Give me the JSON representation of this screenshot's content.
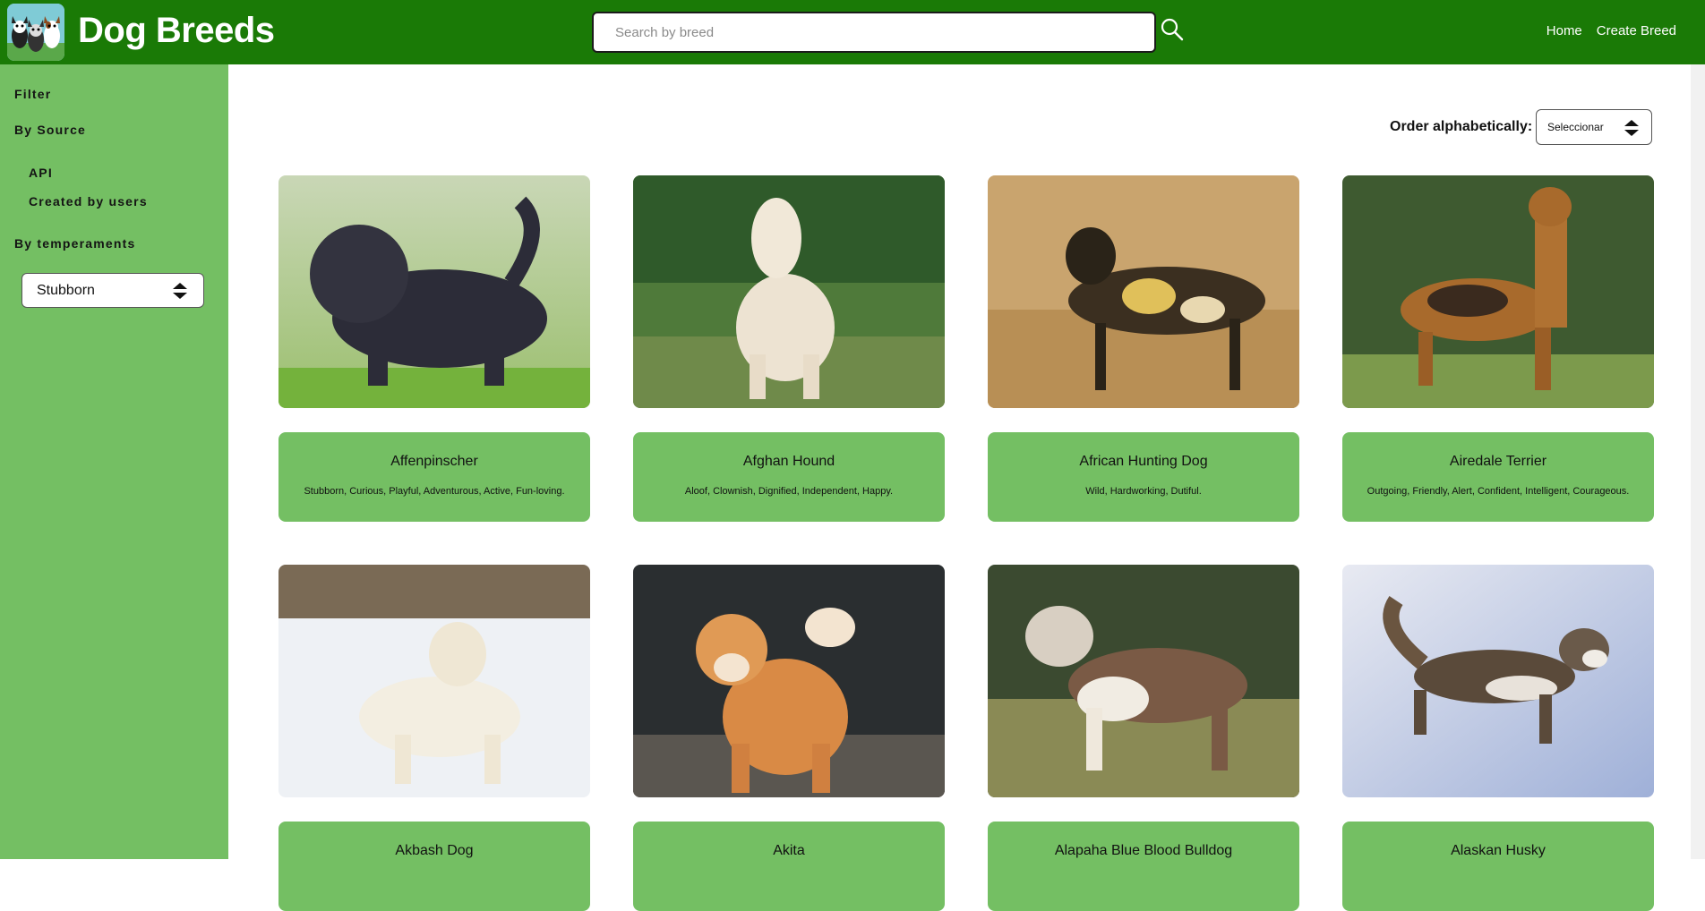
{
  "header": {
    "title": "Dog Breeds",
    "search_placeholder": "Search by breed",
    "nav": [
      "Home",
      "Create Breed"
    ]
  },
  "sidebar": {
    "filter_label": "Filter",
    "by_source_label": "By Source",
    "source_options": [
      "API",
      "Created by users"
    ],
    "by_temperaments_label": "By temperaments",
    "temperament_selected": "Stubborn"
  },
  "order": {
    "label": "Order alphabetically:",
    "selected": "Seleccionar"
  },
  "cards": [
    {
      "name": "Affenpinscher",
      "temperaments": "Stubborn, Curious, Playful, Adventurous, Active, Fun-loving.",
      "image": "black-shaggy-dog"
    },
    {
      "name": "Afghan Hound",
      "temperaments": "Aloof, Clownish, Dignified, Independent, Happy.",
      "image": "cream-long-haired-dog"
    },
    {
      "name": "African Hunting Dog",
      "temperaments": "Wild, Hardworking, Dutiful.",
      "image": "spotted-wild-dog"
    },
    {
      "name": "Airedale Terrier",
      "temperaments": "Outgoing, Friendly, Alert, Confident, Intelligent, Courageous.",
      "image": "tan-terrier"
    },
    {
      "name": "Akbash Dog",
      "temperaments": "",
      "image": "white-dog-snow"
    },
    {
      "name": "Akita",
      "temperaments": "",
      "image": "orange-akita"
    },
    {
      "name": "Alapaha Blue Blood Bulldog",
      "temperaments": "",
      "image": "brown-white-bulldog"
    },
    {
      "name": "Alaskan Husky",
      "temperaments": "",
      "image": "husky-running-snow"
    }
  ],
  "colors": {
    "header_green": "#1a7a06",
    "sidebar_green": "#74bf63",
    "card_green": "#74bf63"
  }
}
